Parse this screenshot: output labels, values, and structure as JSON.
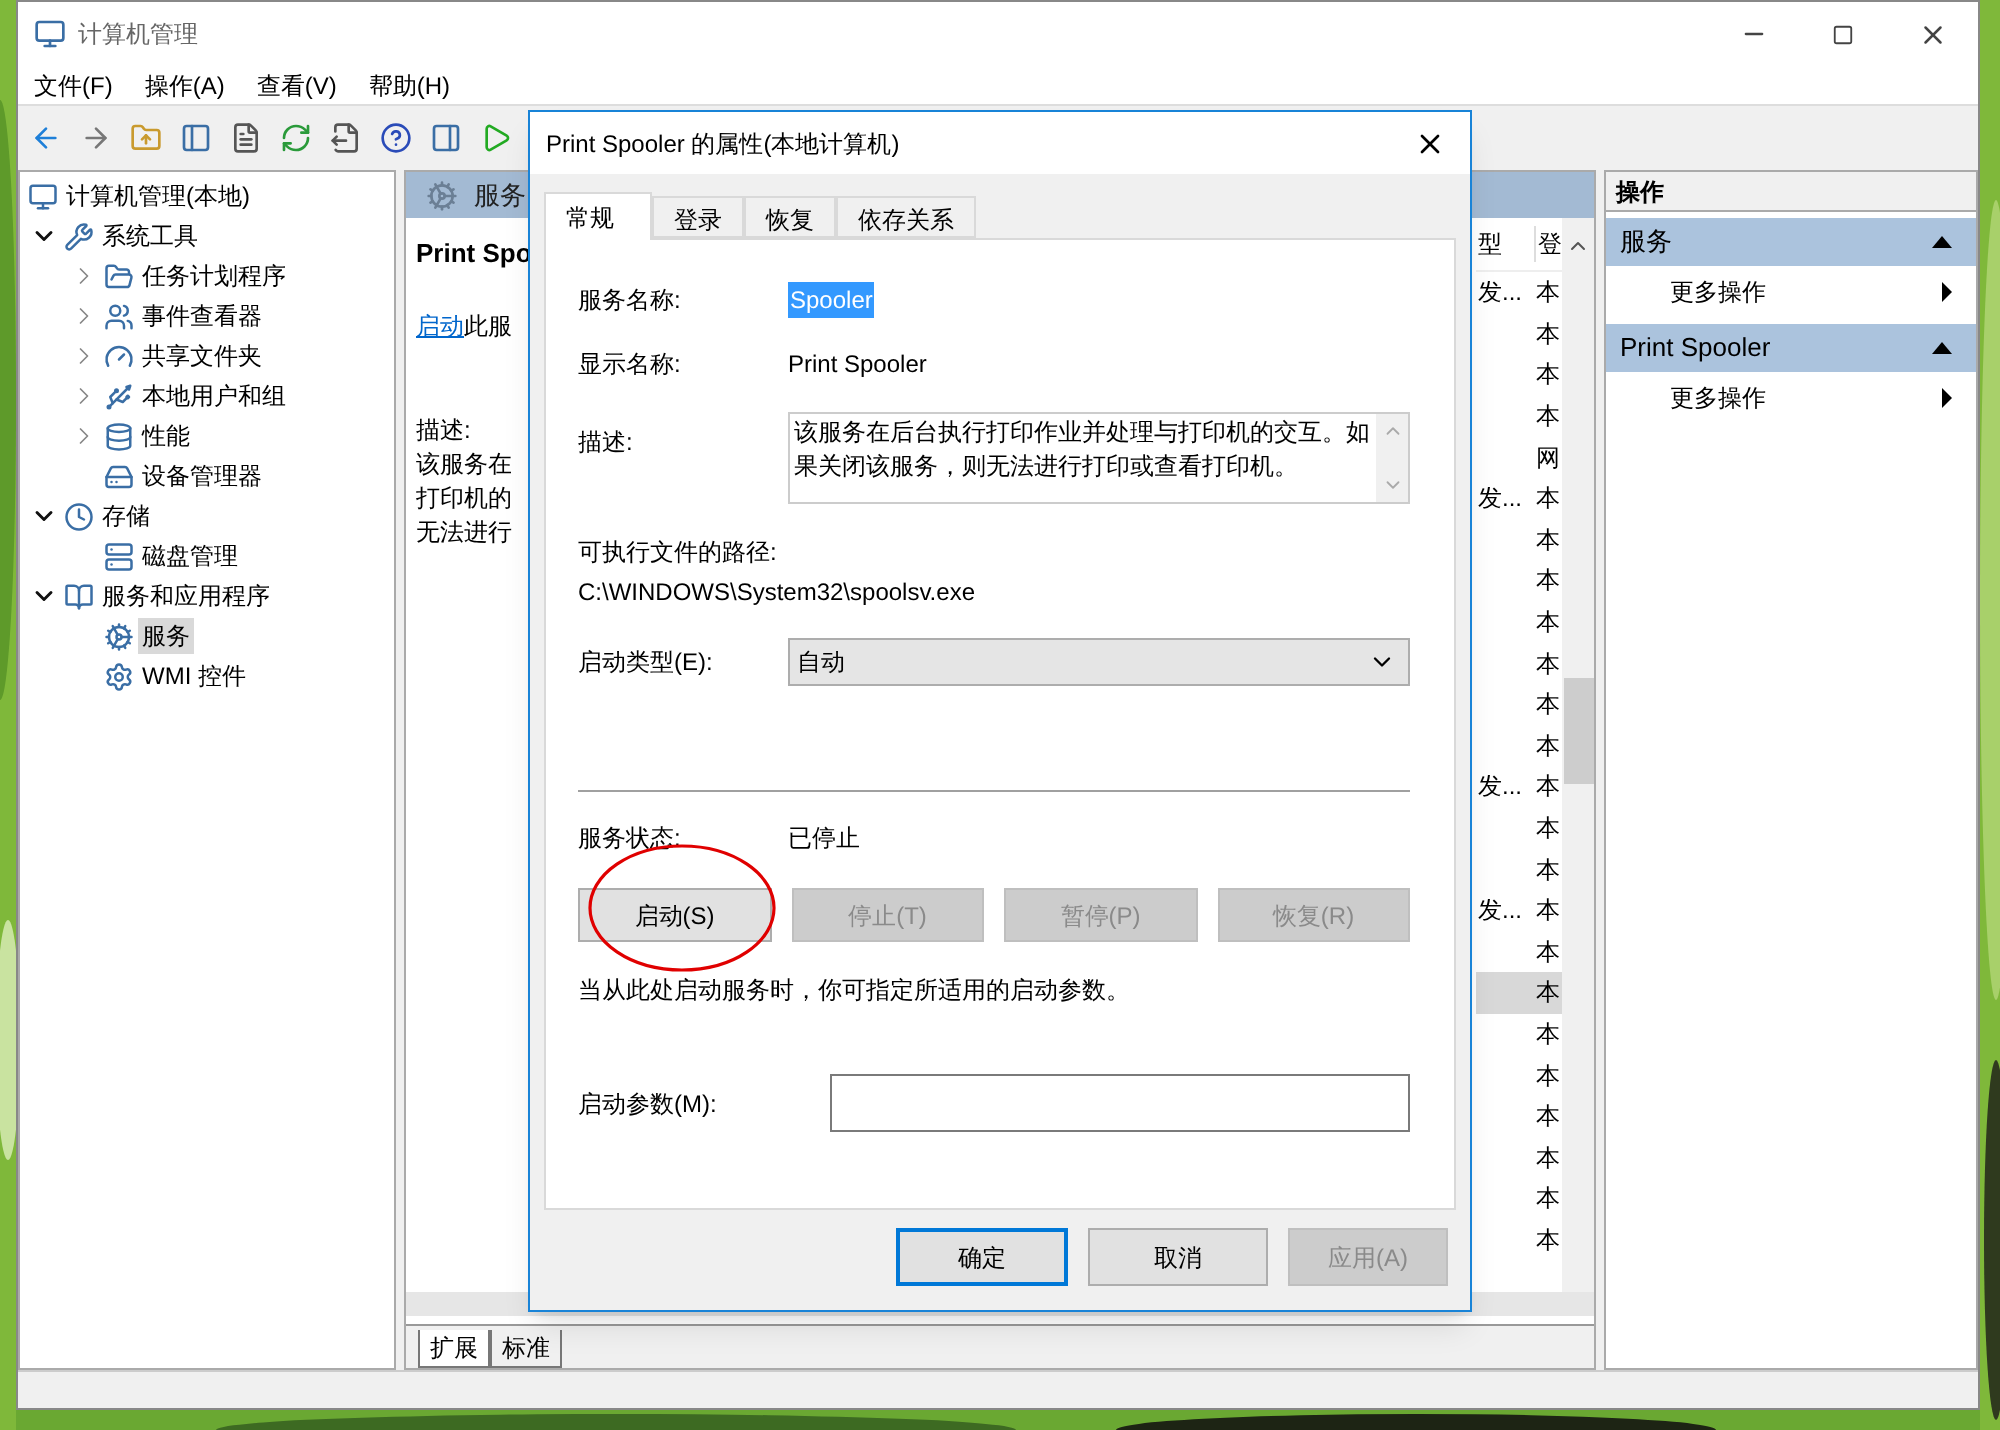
{
  "window": {
    "title": "计算机管理",
    "menu": [
      "文件(F)",
      "操作(A)",
      "查看(V)",
      "帮助(H)"
    ]
  },
  "tree": [
    {
      "label": "计算机管理(本地)",
      "kind": "root",
      "selected": false,
      "children": [
        {
          "label": "系统工具",
          "kind": "expandable",
          "expanded": true,
          "selected": false,
          "children": [
            {
              "label": "任务计划程序",
              "kind": "expandable",
              "expanded": false,
              "selected": false
            },
            {
              "label": "事件查看器",
              "kind": "expandable",
              "expanded": false,
              "selected": false
            },
            {
              "label": "共享文件夹",
              "kind": "expandable",
              "expanded": false,
              "selected": false
            },
            {
              "label": "本地用户和组",
              "kind": "expandable",
              "expanded": false,
              "selected": false
            },
            {
              "label": "性能",
              "kind": "expandable",
              "expanded": false,
              "selected": false
            },
            {
              "label": "设备管理器",
              "kind": "leaf",
              "selected": false
            }
          ]
        },
        {
          "label": "存储",
          "kind": "expandable",
          "expanded": true,
          "selected": false,
          "children": [
            {
              "label": "磁盘管理",
              "kind": "leaf",
              "selected": false
            }
          ]
        },
        {
          "label": "服务和应用程序",
          "kind": "expandable",
          "expanded": true,
          "selected": false,
          "children": [
            {
              "label": "服务",
              "kind": "leaf",
              "selected": true
            },
            {
              "label": "WMI 控件",
              "kind": "leaf",
              "selected": false
            }
          ]
        }
      ]
    }
  ],
  "services_pane": {
    "header": "服务",
    "service_name": "Print Spo",
    "start_link": "启动",
    "start_link_rest": "此服",
    "description_label": "描述:",
    "description_lines": [
      "该服务在",
      "打印机的",
      "无法进行"
    ],
    "columns": [
      "型",
      "登"
    ],
    "rows": [
      {
        "type": "发...",
        "logon": "本",
        "selected": false
      },
      {
        "logon": "本",
        "selected": false
      },
      {
        "logon": "本",
        "selected": false
      },
      {
        "logon": "本",
        "selected": false
      },
      {
        "logon": "网",
        "selected": false
      },
      {
        "type": "发...",
        "logon": "本",
        "selected": false
      },
      {
        "logon": "本",
        "selected": false
      },
      {
        "logon": "本",
        "selected": false
      },
      {
        "logon": "本",
        "selected": false
      },
      {
        "logon": "本",
        "selected": false
      },
      {
        "logon": "本",
        "selected": false
      },
      {
        "logon": "本",
        "selected": false
      },
      {
        "type": "发...",
        "logon": "本",
        "selected": false
      },
      {
        "logon": "本",
        "selected": false
      },
      {
        "logon": "本",
        "selected": false
      },
      {
        "type": "发...",
        "logon": "本",
        "selected": false
      },
      {
        "logon": "本",
        "selected": false
      },
      {
        "logon": "本",
        "selected": true
      },
      {
        "logon": "本",
        "selected": false
      },
      {
        "logon": "本",
        "selected": false
      },
      {
        "logon": "本",
        "selected": false
      },
      {
        "logon": "本",
        "selected": false
      },
      {
        "logon": "本",
        "selected": false
      },
      {
        "logon": "本",
        "selected": false
      }
    ],
    "tabs": [
      {
        "label": "扩展",
        "selected": true
      },
      {
        "label": "标准",
        "selected": false
      }
    ]
  },
  "actions_pane": {
    "title": "操作",
    "sections": [
      {
        "title": "服务",
        "expanded": true,
        "items": [
          "更多操作"
        ]
      },
      {
        "title": "Print Spooler",
        "expanded": true,
        "items": [
          "更多操作"
        ]
      }
    ]
  },
  "dialog": {
    "title": "Print Spooler 的属性(本地计算机)",
    "tabs": [
      {
        "label": "常规",
        "selected": true
      },
      {
        "label": "登录",
        "selected": false
      },
      {
        "label": "恢复",
        "selected": false
      },
      {
        "label": "依存关系",
        "selected": false
      }
    ],
    "service_name": {
      "label": "服务名称:",
      "value": "Spooler",
      "selected": true
    },
    "display_name": {
      "label": "显示名称:",
      "value": "Print Spooler"
    },
    "description": {
      "label": "描述:",
      "value": "该服务在后台执行打印作业并处理与打印机的交互。如果关闭该服务，则无法进行打印或查看打印机。"
    },
    "path": {
      "label": "可执行文件的路径:",
      "value": "C:\\WINDOWS\\System32\\spoolsv.exe"
    },
    "startup_type": {
      "label": "启动类型(E):",
      "value": "自动"
    },
    "status": {
      "label": "服务状态:",
      "value": "已停止"
    },
    "control_buttons": [
      {
        "label": "启动(S)",
        "disabled": false
      },
      {
        "label": "停止(T)",
        "disabled": true
      },
      {
        "label": "暂停(P)",
        "disabled": true
      },
      {
        "label": "恢复(R)",
        "disabled": true
      }
    ],
    "hint": "当从此处启动服务时，你可指定所适用的启动参数。",
    "start_params": {
      "label": "启动参数(M):"
    },
    "footer_buttons": [
      {
        "label": "确定",
        "disabled": false,
        "default": true
      },
      {
        "label": "取消",
        "disabled": false,
        "default": false
      },
      {
        "label": "应用(A)",
        "disabled": true,
        "default": false
      }
    ]
  }
}
